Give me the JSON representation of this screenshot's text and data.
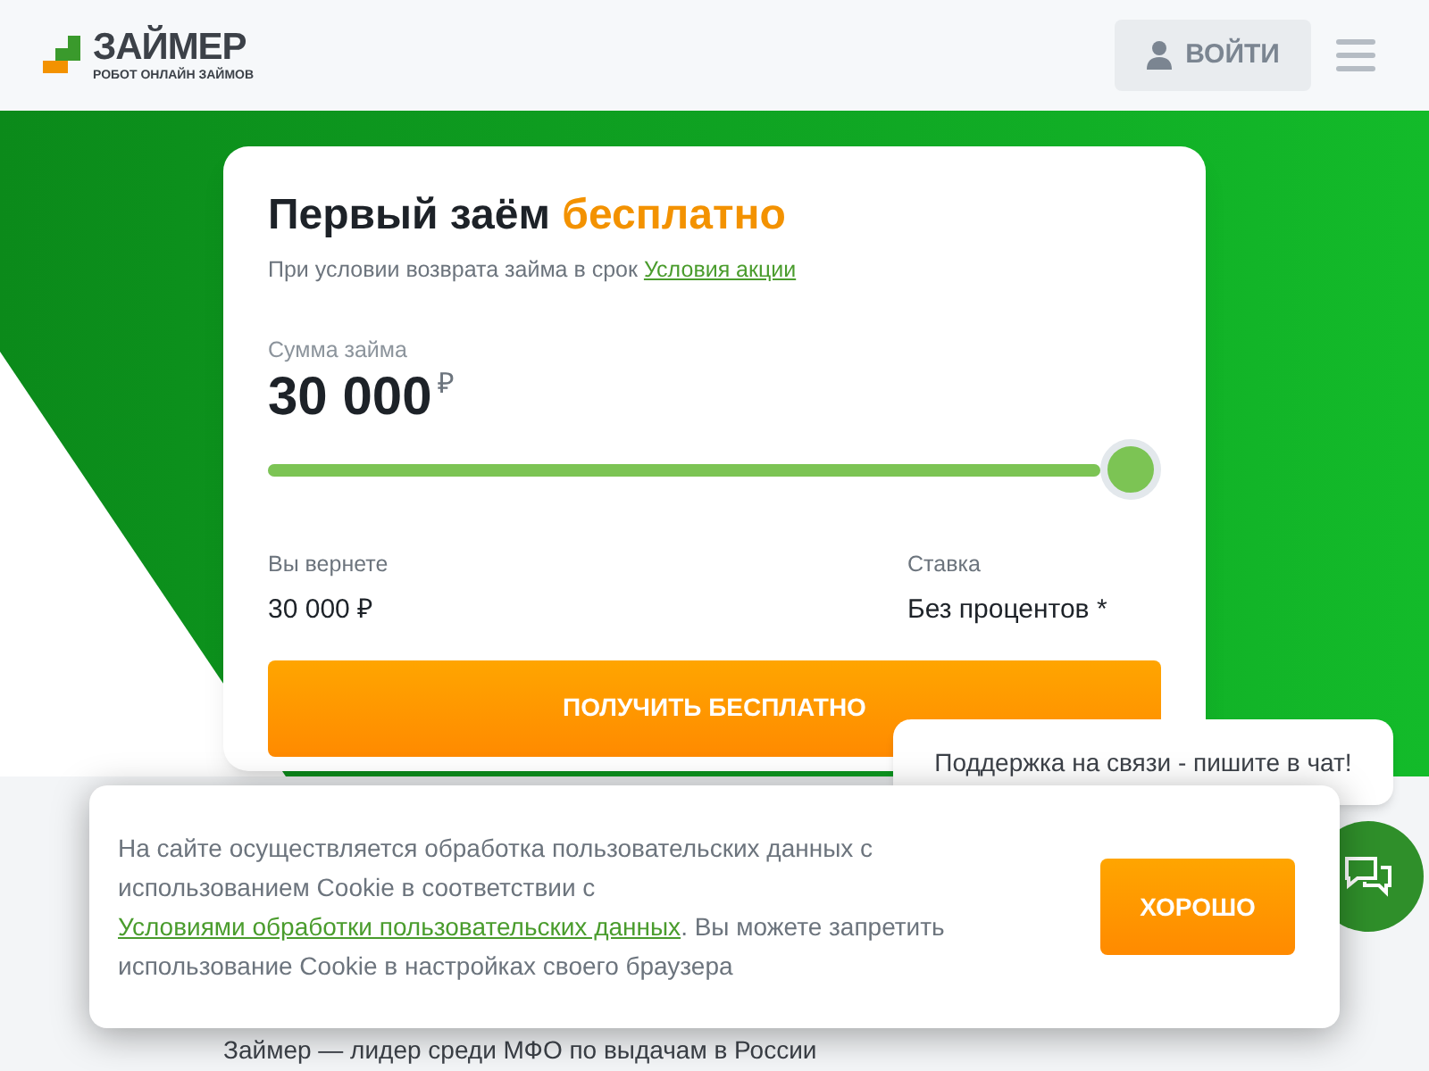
{
  "header": {
    "logo_name": "ЗАЙМЕР",
    "logo_tagline": "РОБОТ ОНЛАЙН ЗАЙМОВ",
    "login_button": "ВОЙТИ"
  },
  "offer": {
    "title": "Первый заём",
    "title_highlight": "бесплатно",
    "subtitle": "При условии возврата займа в срок",
    "subtitle_link": "Условия акции",
    "amount_label": "Сумма займа",
    "amount": "30 000",
    "currency": "₽",
    "slider": {
      "level": 1
    },
    "return_label": "Вы вернете",
    "return_value": "30 000 ₽",
    "rate_label": "Ставка",
    "rate_value": "Без процентов *",
    "cta_button": "ПОЛУЧИТЬ БЕСПЛАТНО"
  },
  "tagline": "Займер — лидер среди МФО по выдачам в России",
  "chat": {
    "bubble": "Поддержка на связи - пишите в чат!"
  },
  "cookie_banner": {
    "text_before": "На сайте осуществляется обработка пользовательских данных с использованием Cookie в соответствии с",
    "link": "Условиями обработки пользовательских данных",
    "text_after": ". Вы можете запретить использование Cookie в настройках своего браузера",
    "ok_button": "ХОРОШО"
  }
}
